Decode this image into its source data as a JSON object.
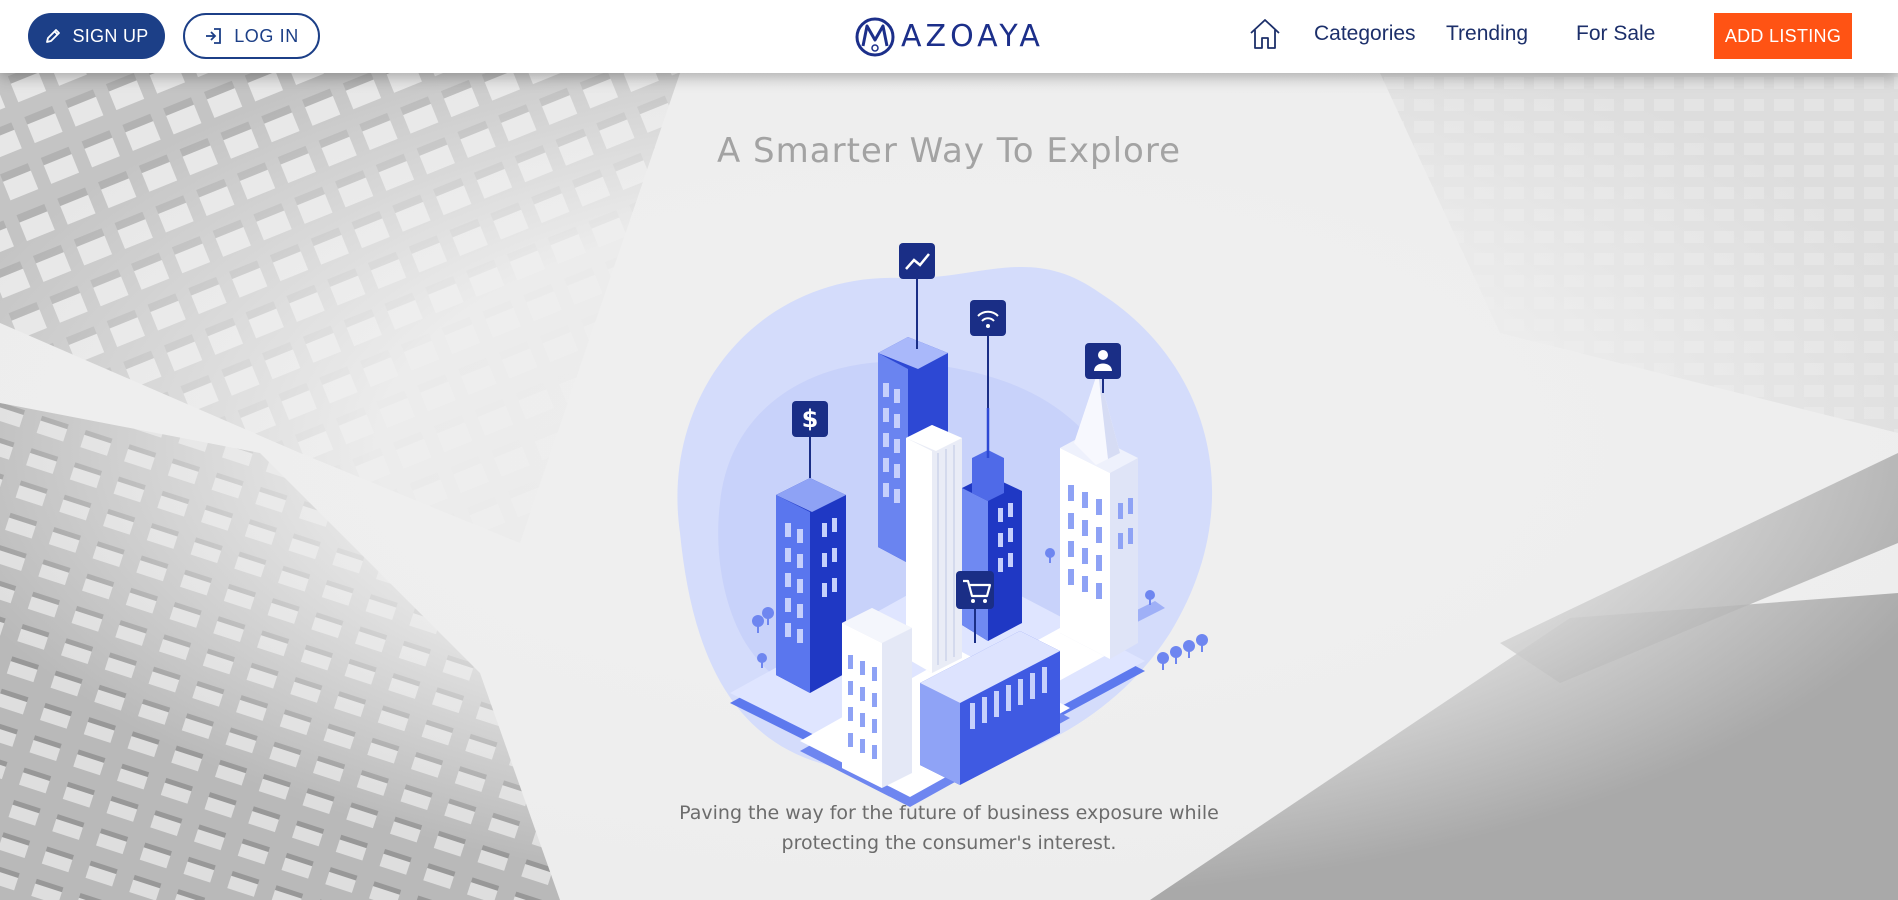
{
  "header": {
    "signup_label": "SIGN UP",
    "login_label": "LOG IN",
    "logo_text": "AZOAYA",
    "logo_initial": "M",
    "nav": {
      "home_icon": "home-icon",
      "categories": "Categories",
      "trending": "Trending",
      "for_sale": "For Sale"
    },
    "add_listing_label": "ADD LISTING",
    "colors": {
      "primary": "#1c3f87",
      "accent": "#ff5314",
      "logo": "#1c2f8a"
    }
  },
  "hero": {
    "title": "A Smarter Way To Explore",
    "tagline_line1": "Paving the way for the future of business exposure while",
    "tagline_line2": "protecting the consumer's interest.",
    "illustration_icons": [
      "chart-icon",
      "wifi-icon",
      "user-icon",
      "dollar-icon",
      "cart-icon"
    ],
    "dollar_symbol": "$"
  }
}
